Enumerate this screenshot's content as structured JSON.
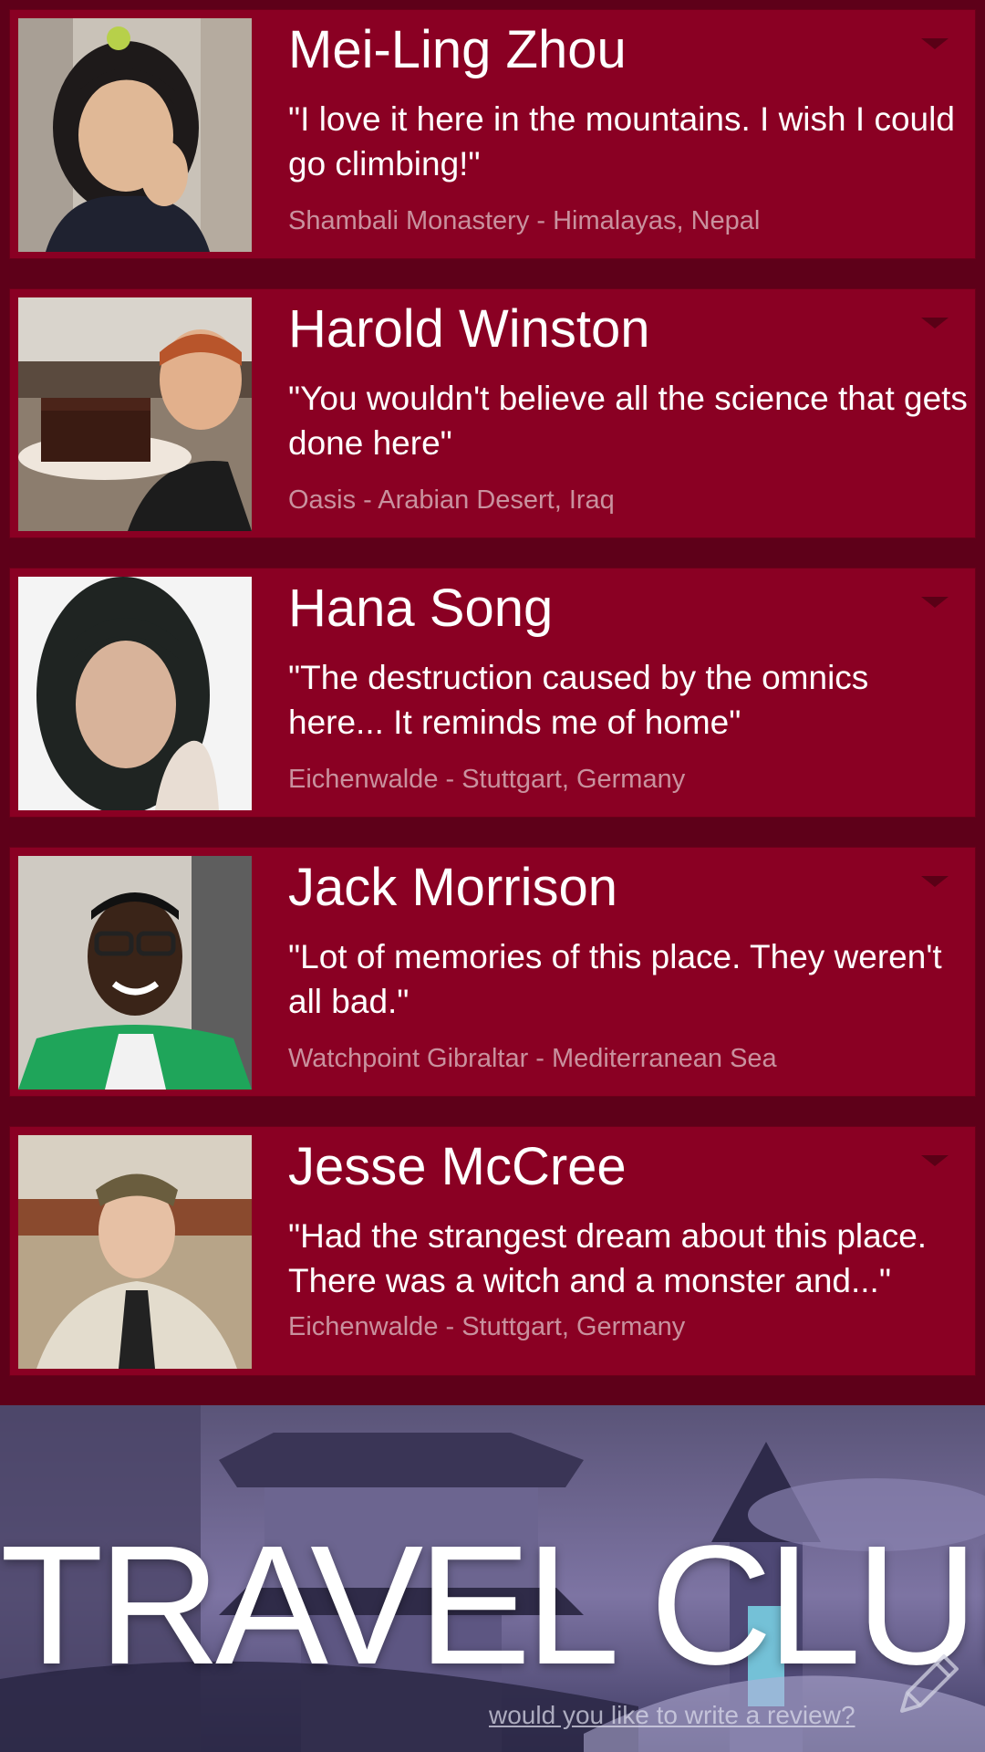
{
  "reviews": [
    {
      "name": "Mei-Ling Zhou",
      "quote": "\"I love it here in the mountains. I wish I could go climbing!\"",
      "location": "Shambali Monastery - Himalayas, Nepal"
    },
    {
      "name": "Harold Winston",
      "quote": "\"You wouldn't believe all the science that gets done here\"",
      "location": "Oasis - Arabian Desert, Iraq"
    },
    {
      "name": "Hana Song",
      "quote": "\"The destruction caused by the omnics here... It reminds me of home\"",
      "location": "Eichenwalde - Stuttgart, Germany"
    },
    {
      "name": "Jack Morrison",
      "quote": "\"Lot of memories of this place. They weren't all bad.\"",
      "location": "Watchpoint Gibraltar - Mediterranean Sea"
    },
    {
      "name": "Jesse McCree",
      "quote": "\"Had the strangest dream about this place. There was a witch and a monster and...\"",
      "location": "Eichenwalde - Stuttgart, Germany"
    }
  ],
  "hero": {
    "title": "TRAVEL CLUB",
    "review_link": "would you like to write a review?"
  },
  "icons": {
    "expand": "chevron-down-icon",
    "write": "pencil-icon"
  },
  "colors": {
    "page_background": "#5e0019",
    "card_background": "#8a0023",
    "location_text": "#c9919e"
  }
}
